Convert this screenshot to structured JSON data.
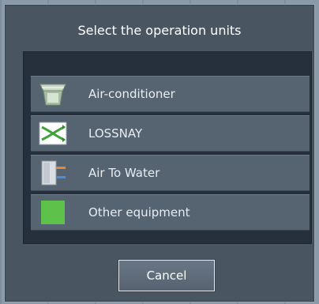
{
  "dialog": {
    "title": "Select the operation units",
    "items": [
      {
        "label": "Air-conditioner",
        "icon": "ceiling-cassette-ac-icon"
      },
      {
        "label": "LOSSNAY",
        "icon": "lossnay-ventilation-icon"
      },
      {
        "label": "Air To Water",
        "icon": "air-to-water-unit-icon"
      },
      {
        "label": "Other equipment",
        "icon": "green-square-icon",
        "color": "#5ec24a"
      }
    ],
    "cancel_label": "Cancel"
  }
}
